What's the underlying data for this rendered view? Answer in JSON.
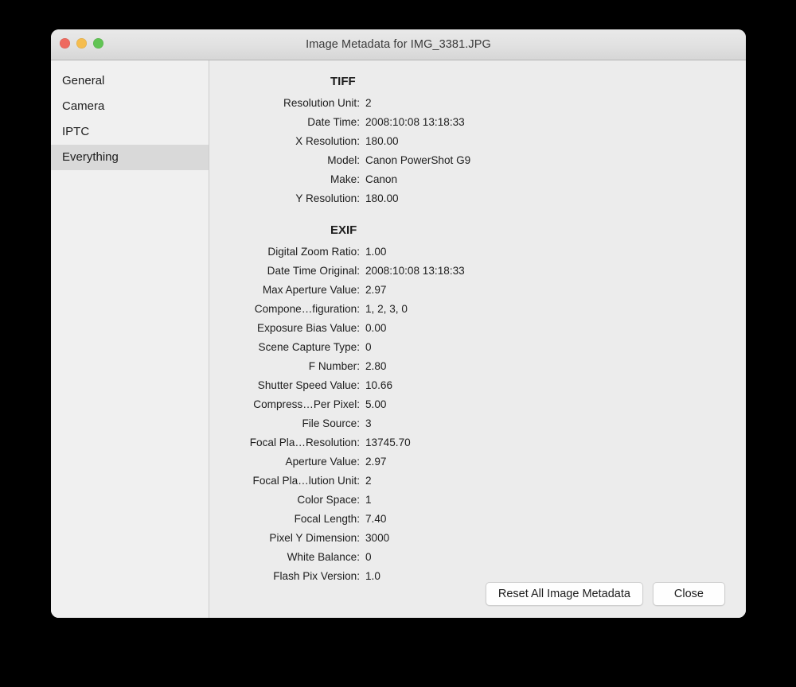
{
  "window": {
    "title": "Image Metadata for IMG_3381.JPG",
    "traffic_lights": {
      "close": "close-button",
      "minimize": "minimize-button",
      "zoom": "zoom-button"
    },
    "colors": {
      "close": "#ee6a5f",
      "minimize": "#f5bd4f",
      "zoom": "#61c454",
      "titlebar": "#e2e2e2",
      "sidebar": "#f0f0f0",
      "content": "#ececec",
      "selection": "#d9d9d9"
    }
  },
  "sidebar": {
    "items": [
      {
        "label": "General",
        "selected": false
      },
      {
        "label": "Camera",
        "selected": false
      },
      {
        "label": "IPTC",
        "selected": false
      },
      {
        "label": "Everything",
        "selected": true
      }
    ]
  },
  "content": {
    "sections": [
      {
        "title": "TIFF",
        "rows": [
          {
            "label": "Resolution Unit:",
            "value": "2"
          },
          {
            "label": "Date Time:",
            "value": "2008:10:08 13:18:33"
          },
          {
            "label": "X Resolution:",
            "value": "180.00"
          },
          {
            "label": "Model:",
            "value": "Canon PowerShot G9"
          },
          {
            "label": "Make:",
            "value": "Canon"
          },
          {
            "label": "Y Resolution:",
            "value": "180.00"
          }
        ]
      },
      {
        "title": "EXIF",
        "rows": [
          {
            "label": "Digital Zoom Ratio:",
            "value": "1.00"
          },
          {
            "label": "Date Time Original:",
            "value": "2008:10:08 13:18:33"
          },
          {
            "label": "Max Aperture Value:",
            "value": "2.97"
          },
          {
            "label": "Compone…figuration:",
            "value": "1, 2, 3, 0"
          },
          {
            "label": "Exposure Bias Value:",
            "value": "0.00"
          },
          {
            "label": "Scene Capture Type:",
            "value": "0"
          },
          {
            "label": "F Number:",
            "value": "2.80"
          },
          {
            "label": "Shutter Speed Value:",
            "value": "10.66"
          },
          {
            "label": "Compress…Per Pixel:",
            "value": "5.00"
          },
          {
            "label": "File Source:",
            "value": "3"
          },
          {
            "label": "Focal Pla…Resolution:",
            "value": "13745.70"
          },
          {
            "label": "Aperture Value:",
            "value": "2.97"
          },
          {
            "label": "Focal Pla…lution Unit:",
            "value": "2"
          },
          {
            "label": "Color Space:",
            "value": "1"
          },
          {
            "label": "Focal Length:",
            "value": "7.40"
          },
          {
            "label": "Pixel Y Dimension:",
            "value": "3000"
          },
          {
            "label": "White Balance:",
            "value": "0"
          },
          {
            "label": "Flash Pix Version:",
            "value": "1.0"
          }
        ]
      }
    ]
  },
  "footer": {
    "reset_label": "Reset All Image Metadata",
    "close_label": "Close"
  }
}
